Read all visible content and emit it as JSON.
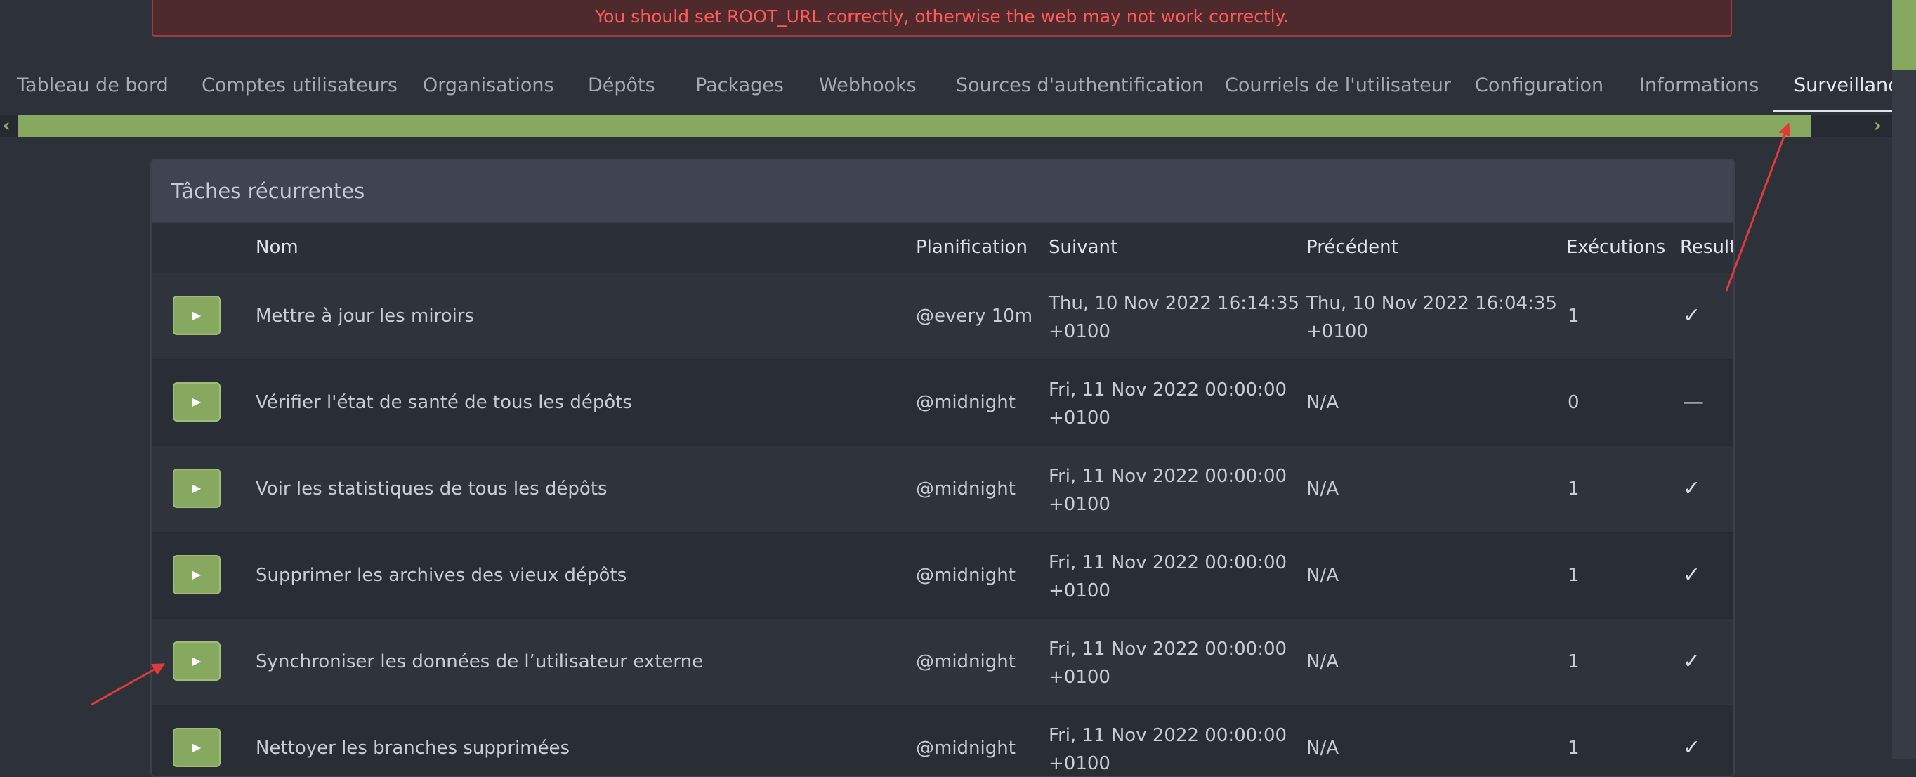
{
  "warning": {
    "text": "You should set ROOT_URL correctly, otherwise the web may not work correctly."
  },
  "nav": {
    "tabs": [
      {
        "label": "Tableau de bord"
      },
      {
        "label": "Comptes utilisateurs"
      },
      {
        "label": "Organisations"
      },
      {
        "label": "Dépôts"
      },
      {
        "label": "Packages"
      },
      {
        "label": "Webhooks"
      },
      {
        "label": "Sources d'authentification"
      },
      {
        "label": "Courriels de l'utilisateur"
      },
      {
        "label": "Configuration"
      },
      {
        "label": "Informations"
      },
      {
        "label": "Surveillance"
      }
    ],
    "active_tab": "Surveillance",
    "scroll_left_glyph": "‹",
    "scroll_right_glyph": "›"
  },
  "panel": {
    "title": "Tâches récurrentes",
    "columns": {
      "name": "Nom",
      "schedule": "Planification",
      "next": "Suivant",
      "previous": "Précédent",
      "executions": "Exécutions",
      "result": "Result"
    },
    "run_icon": "▶",
    "rows": [
      {
        "name": "Mettre à jour les miroirs",
        "schedule": "@every 10m",
        "next_1": "Thu, 10 Nov 2022 16:14:35",
        "next_2": "+0100",
        "prev_1": "Thu, 10 Nov 2022 16:04:35",
        "prev_2": "+0100",
        "executions": "1",
        "result": "✓"
      },
      {
        "name": "Vérifier l'état de santé de tous les dépôts",
        "schedule": "@midnight",
        "next_1": "Fri, 11 Nov 2022 00:00:00",
        "next_2": "+0100",
        "prev_1": "N/A",
        "prev_2": "",
        "executions": "0",
        "result": "—"
      },
      {
        "name": "Voir les statistiques de tous les dépôts",
        "schedule": "@midnight",
        "next_1": "Fri, 11 Nov 2022 00:00:00",
        "next_2": "+0100",
        "prev_1": "N/A",
        "prev_2": "",
        "executions": "1",
        "result": "✓"
      },
      {
        "name": "Supprimer les archives des vieux dépôts",
        "schedule": "@midnight",
        "next_1": "Fri, 11 Nov 2022 00:00:00",
        "next_2": "+0100",
        "prev_1": "N/A",
        "prev_2": "",
        "executions": "1",
        "result": "✓"
      },
      {
        "name": "Synchroniser les données de l’utilisateur externe",
        "schedule": "@midnight",
        "next_1": "Fri, 11 Nov 2022 00:00:00",
        "next_2": "+0100",
        "prev_1": "N/A",
        "prev_2": "",
        "executions": "1",
        "result": "✓"
      },
      {
        "name": "Nettoyer les branches supprimées",
        "schedule": "@midnight",
        "next_1": "Fri, 11 Nov 2022 00:00:00",
        "next_2": "+0100",
        "prev_1": "N/A",
        "prev_2": "",
        "executions": "1",
        "result": "✓"
      }
    ]
  },
  "colors": {
    "accent_green": "#87a95f",
    "warning_red": "#ff5b5b",
    "annotation_arrow": "#e03a3a"
  }
}
